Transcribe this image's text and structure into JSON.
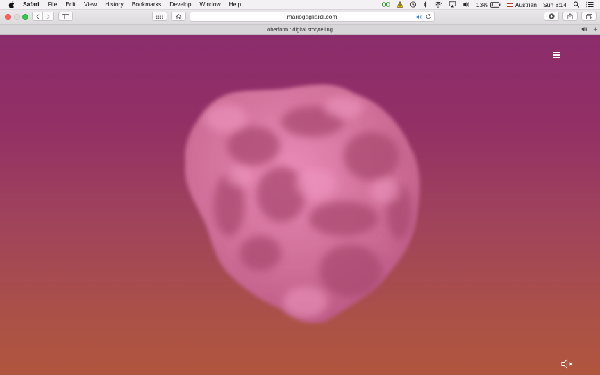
{
  "menubar": {
    "app": "Safari",
    "items": [
      "File",
      "Edit",
      "View",
      "History",
      "Bookmarks",
      "Develop",
      "Window",
      "Help"
    ],
    "battery": "13%",
    "input_source": "Austrian",
    "clock": "Sun 8:14",
    "icons": [
      "apple-icon",
      "link-status-icon",
      "warning-icon",
      "time-machine-icon",
      "bluetooth-icon",
      "wifi-icon",
      "airplay-icon",
      "volume-icon",
      "battery-icon",
      "flag-icon",
      "spotlight-icon",
      "notification-center-icon"
    ]
  },
  "toolbar": {
    "url": "mariogagliardi.com",
    "icons": [
      "back-icon",
      "forward-icon",
      "sidebar-icon",
      "top-sites-icon",
      "home-icon",
      "audio-icon",
      "reload-icon",
      "download-icon",
      "share-icon",
      "tabs-overview-icon"
    ]
  },
  "tab": {
    "title": "oberform : digital storytelling"
  },
  "page": {
    "background_top": "#8b2d6c",
    "background_bottom": "#b0553d",
    "blob_color": "#e07aa5",
    "icons": [
      "hamburger-menu-icon",
      "muted-speaker-icon"
    ]
  }
}
